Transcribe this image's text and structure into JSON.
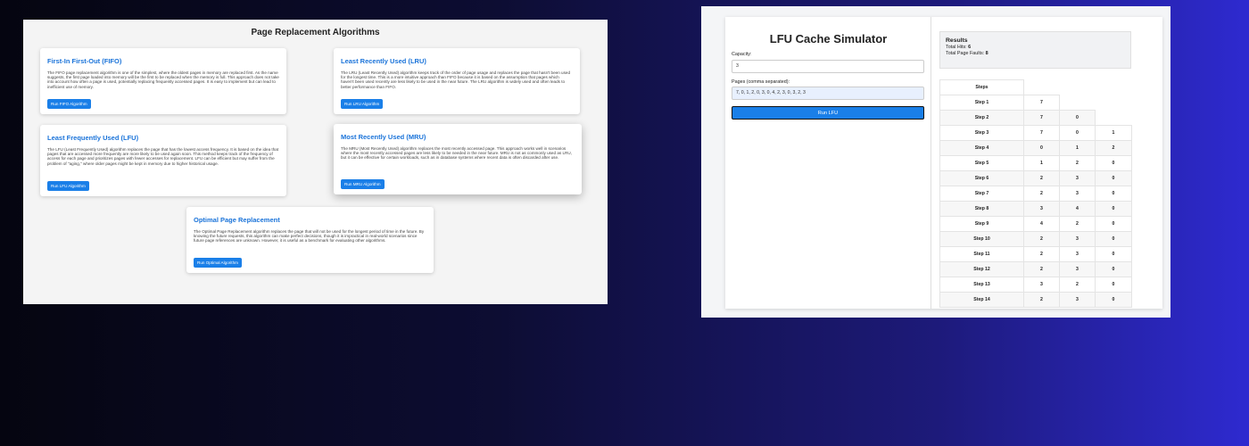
{
  "left": {
    "title": "Page Replacement Algorithms",
    "cards": [
      {
        "title": "First-In First-Out (FIFO)",
        "description": "The FIFO page replacement algorithm is one of the simplest, where the oldest pages in memory are replaced first. As the name suggests, the first page loaded into memory will be the first to be replaced when the memory is full. This approach does not take into account how often a page is used, potentially replacing frequently accessed pages. It is easy to implement but can lead to inefficient use of memory.",
        "button": "Run FIFO Algorithm"
      },
      {
        "title": "Least Recently Used (LRU)",
        "description": "The LRU (Least Recently Used) algorithm keeps track of the order of page usage and replaces the page that hasn't been used for the longest time. This is a more intuitive approach than FIFO because it is based on the assumption that pages which haven't been used recently are less likely to be used in the near future. The LRU algorithm is widely used and often leads to better performance than FIFO.",
        "button": "Run LRU Algorithm"
      },
      {
        "title": "Least Frequently Used (LFU)",
        "description": "The LFU (Least Frequently Used) algorithm replaces the page that has the lowest access frequency. It is based on the idea that pages that are accessed more frequently are more likely to be used again soon. This method keeps track of the frequency of access for each page and prioritizes pages with fewer accesses for replacement. LFU can be efficient but may suffer from the problem of \"aging,\" where older pages might be kept in memory due to higher historical usage.",
        "button": "Run LFU Algorithm"
      },
      {
        "title": "Most Recently Used (MRU)",
        "description": "The MRU (Most Recently Used) algorithm replaces the most recently accessed page. This approach works well in scenarios where the most recently accessed pages are less likely to be needed in the near future. MRU is not as commonly used as LRU, but it can be effective for certain workloads, such as in database systems where recent data is often discarded after use.",
        "button": "Run MRU Algorithm"
      },
      {
        "title": "Optimal Page Replacement",
        "description": "The Optimal Page Replacement algorithm replaces the page that will not be used for the longest period of time in the future. By knowing the future requests, this algorithm can make perfect decisions, though it is impractical in real-world scenarios since future page references are unknown. However, it is useful as a benchmark for evaluating other algorithms.",
        "button": "Run Optimal Algorithm"
      }
    ]
  },
  "right": {
    "title": "LFU Cache Simulator",
    "capacity_label": "Capacity:",
    "capacity_value": "3",
    "pages_label": "Pages (comma separated):",
    "pages_value": "7, 0, 1, 2, 0, 3, 0, 4, 2, 3, 0, 3, 2, 3",
    "run_button": "Run LFU",
    "results_title": "Results",
    "hits_label": "Total Hits:",
    "hits_value": "6",
    "faults_label": "Total Page Faults:",
    "faults_value": "8",
    "table_header": "Steps",
    "steps": [
      {
        "label": "Step 1",
        "frames": [
          "7"
        ]
      },
      {
        "label": "Step 2",
        "frames": [
          "7",
          "0"
        ]
      },
      {
        "label": "Step 3",
        "frames": [
          "7",
          "0",
          "1"
        ]
      },
      {
        "label": "Step 4",
        "frames": [
          "0",
          "1",
          "2"
        ]
      },
      {
        "label": "Step 5",
        "frames": [
          "1",
          "2",
          "0"
        ]
      },
      {
        "label": "Step 6",
        "frames": [
          "2",
          "3",
          "0"
        ]
      },
      {
        "label": "Step 7",
        "frames": [
          "2",
          "3",
          "0"
        ]
      },
      {
        "label": "Step 8",
        "frames": [
          "3",
          "4",
          "0"
        ]
      },
      {
        "label": "Step 9",
        "frames": [
          "4",
          "2",
          "0"
        ]
      },
      {
        "label": "Step 10",
        "frames": [
          "2",
          "3",
          "0"
        ]
      },
      {
        "label": "Step 11",
        "frames": [
          "2",
          "3",
          "0"
        ]
      },
      {
        "label": "Step 12",
        "frames": [
          "2",
          "3",
          "0"
        ]
      },
      {
        "label": "Step 13",
        "frames": [
          "3",
          "2",
          "0"
        ]
      },
      {
        "label": "Step 14",
        "frames": [
          "2",
          "3",
          "0"
        ]
      }
    ]
  },
  "colors": {
    "accent": "#1a7fe8",
    "card_title": "#1a73d9"
  }
}
